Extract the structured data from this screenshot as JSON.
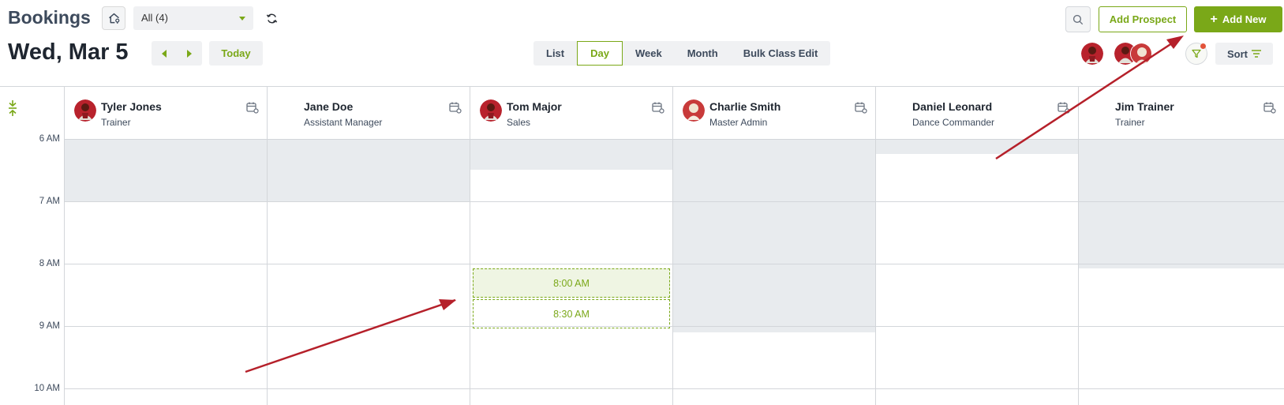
{
  "header": {
    "title": "Bookings",
    "location_select": "All (4)",
    "add_prospect_label": "Add Prospect",
    "add_new_label": "Add New",
    "add_new_icon": "plus-icon"
  },
  "toolbar": {
    "date_title": "Wed, Mar 5",
    "today_label": "Today",
    "views": [
      {
        "label": "List",
        "active": false
      },
      {
        "label": "Day",
        "active": true
      },
      {
        "label": "Week",
        "active": false
      },
      {
        "label": "Month",
        "active": false
      },
      {
        "label": "Bulk Class Edit",
        "active": false
      }
    ],
    "sort_label": "Sort"
  },
  "calendar": {
    "time_labels": [
      "6 AM",
      "7 AM",
      "8 AM",
      "9 AM",
      "10 AM"
    ],
    "staff": [
      {
        "name": "Tyler Jones",
        "role": "Trainer",
        "avatar": "player-red"
      },
      {
        "name": "Jane Doe",
        "role": "Assistant Manager",
        "avatar": ""
      },
      {
        "name": "Tom Major",
        "role": "Sales",
        "avatar": "player-red"
      },
      {
        "name": "Charlie Smith",
        "role": "Master Admin",
        "avatar": "player-light"
      },
      {
        "name": "Daniel Leonard",
        "role": "Dance Commander",
        "avatar": ""
      },
      {
        "name": "Jim Trainer",
        "role": "Trainer",
        "avatar": ""
      }
    ],
    "slots": [
      {
        "label": "8:00 AM",
        "selected": true
      },
      {
        "label": "8:30 AM",
        "selected": false
      }
    ]
  },
  "colors": {
    "accent": "#7aa818",
    "unavailable": "#e8ebee",
    "annotation_arrow": "#b5202a"
  }
}
